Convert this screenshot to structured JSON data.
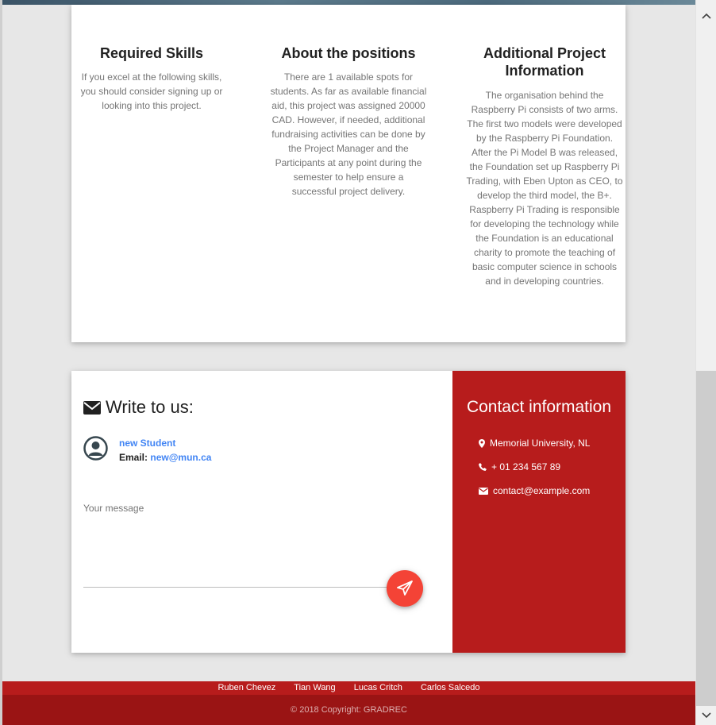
{
  "skills": {
    "title": "Required Skills",
    "text": "If you excel at the following skills, you should consider signing up or looking into this project."
  },
  "positions": {
    "title": "About the positions",
    "text": "There are 1 available spots for students. As far as available financial aid, this project was assigned 20000 CAD. However, if needed, additional fundraising activities can be done by the Project Manager and the Participants at any point during the semester to help ensure a successful project delivery."
  },
  "additional": {
    "title": "Additional Project Information",
    "text": "The organisation behind the Raspberry Pi consists of two arms. The first two models were developed by the Raspberry Pi Foundation. After the Pi Model B was released, the Foundation set up Raspberry Pi Trading, with Eben Upton as CEO, to develop the third model, the B+. Raspberry Pi Trading is responsible for developing the technology while the Foundation is an educational charity to promote the teaching of basic computer science in schools and in developing countries."
  },
  "write": {
    "title": "Write to us:",
    "user_name": "new Student",
    "email_label": "Email:",
    "email": "new@mun.ca",
    "message_label": "Your message"
  },
  "contact": {
    "title": "Contact information",
    "address": "Memorial University, NL",
    "phone": "+ 01 234 567 89",
    "email": "contact@example.com"
  },
  "footer": {
    "names": [
      "Ruben Chevez",
      "Tian Wang",
      "Lucas Critch",
      "Carlos Salcedo"
    ],
    "copyright": "© 2018 Copyright: GRADREC"
  },
  "colors": {
    "accent_red": "#b71c1c",
    "send_button": "#f44336",
    "link_blue": "#4285f4"
  }
}
